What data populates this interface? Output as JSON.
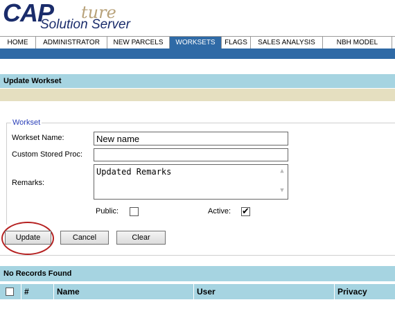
{
  "logo": {
    "cap": "CAP",
    "ture": "ture",
    "sub": "Solution Server"
  },
  "nav": {
    "tabs": [
      {
        "label": "HOME"
      },
      {
        "label": "ADMINISTRATOR"
      },
      {
        "label": "NEW PARCELS"
      },
      {
        "label": "WORKSETS",
        "active": true
      },
      {
        "label": "FLAGS"
      },
      {
        "label": "SALES ANALYSIS"
      },
      {
        "label": "NBH MODEL"
      }
    ]
  },
  "update_section": {
    "title": "Update Workset"
  },
  "form": {
    "legend": "Workset",
    "name_label": "Workset Name:",
    "name_value": "New name",
    "proc_label": "Custom Stored Proc:",
    "proc_value": "",
    "remarks_label": "Remarks:",
    "remarks_value": "Updated Remarks",
    "public_label": "Public:",
    "public_checked": false,
    "active_label": "Active:",
    "active_checked": true
  },
  "buttons": {
    "update": "Update",
    "cancel": "Cancel",
    "clear": "Clear"
  },
  "records": {
    "status": "No Records Found",
    "columns": [
      "#",
      "Name",
      "User",
      "Privacy"
    ]
  },
  "colors": {
    "nav_active": "#2f6aa6",
    "section_header": "#a6d4e1",
    "tan": "#e5dfc0",
    "highlight": "#b52020"
  }
}
